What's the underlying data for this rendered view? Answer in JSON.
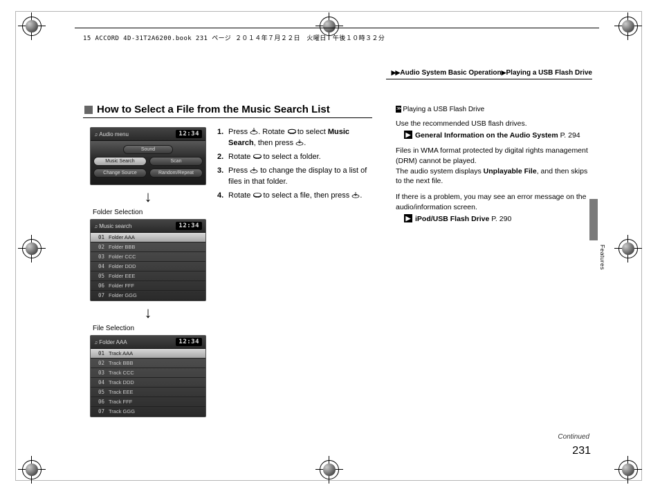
{
  "meta_header": "15 ACCORD 4D-31T2A6200.book  231 ページ  ２０１４年７月２２日　火曜日　午後１０時３２分",
  "breadcrumb": {
    "seg1": "Audio System Basic Operation",
    "seg2": "Playing a USB Flash Drive"
  },
  "title": "How to Select a File from the Music Search List",
  "clock": "12:34",
  "screen1": {
    "title": "Audio menu",
    "buttons": {
      "sound": "Sound",
      "music_search": "Music Search",
      "scan": "Scan",
      "change_source": "Change Source",
      "random_repeat": "Random/Repeat"
    }
  },
  "caption_folder": "Folder Selection",
  "screen2": {
    "title": "Music search",
    "items": [
      {
        "n": "01",
        "t": "Folder AAA"
      },
      {
        "n": "02",
        "t": "Folder BBB"
      },
      {
        "n": "03",
        "t": "Folder CCC"
      },
      {
        "n": "04",
        "t": "Folder DDD"
      },
      {
        "n": "05",
        "t": "Folder EEE"
      },
      {
        "n": "06",
        "t": "Folder FFF"
      },
      {
        "n": "07",
        "t": "Folder GGG"
      }
    ]
  },
  "caption_file": "File Selection",
  "screen3": {
    "title": "Folder AAA",
    "items": [
      {
        "n": "01",
        "t": "Track AAA"
      },
      {
        "n": "02",
        "t": "Track BBB"
      },
      {
        "n": "03",
        "t": "Track CCC"
      },
      {
        "n": "04",
        "t": "Track DDD"
      },
      {
        "n": "05",
        "t": "Track EEE"
      },
      {
        "n": "06",
        "t": "Track FFF"
      },
      {
        "n": "07",
        "t": "Track GGG"
      }
    ]
  },
  "steps": {
    "s1a": "Press ",
    "s1b": ". Rotate ",
    "s1c": " to select ",
    "s1_bold": "Music Search",
    "s1d": ", then press ",
    "s1e": ".",
    "s2a": "Rotate ",
    "s2b": " to select a folder.",
    "s3a": "Press ",
    "s3b": " to change the display to a list of files in that folder.",
    "s4a": "Rotate ",
    "s4b": " to select a file, then press ",
    "s4c": "."
  },
  "sidebar": {
    "heading": "Playing a USB Flash Drive",
    "line1": "Use the recommended USB flash drives.",
    "ref1_bold": "General Information on the Audio System",
    "ref1_page": "P. 294",
    "para2a": "Files in WMA format protected by digital rights management (DRM) cannot be played.",
    "para2b_pre": "The audio system displays ",
    "para2b_bold": "Unplayable File",
    "para2b_post": ", and then skips to the next file.",
    "para3": "If there is a problem, you may see an error message on the audio/information screen.",
    "ref2_bold": "iPod/USB Flash Drive",
    "ref2_page": "P. 290"
  },
  "tab_label": "Features",
  "continued": "Continued",
  "page_number": "231"
}
